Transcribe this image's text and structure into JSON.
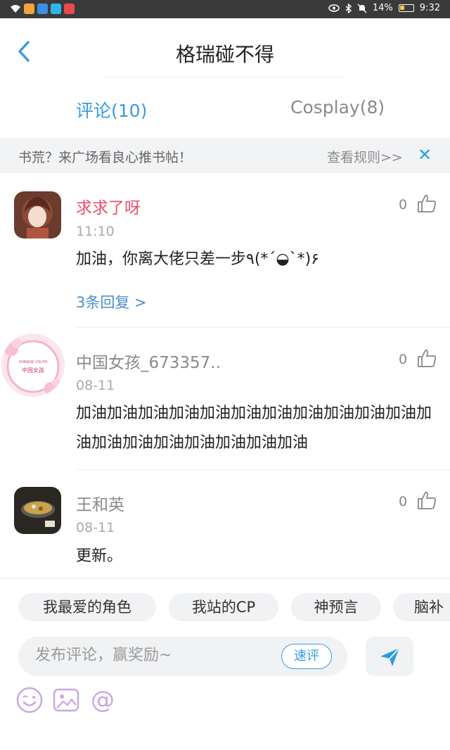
{
  "status_bar": {
    "battery": "14%",
    "time": "9:32",
    "app_icon_colors": [
      "#f2a33a",
      "#3a8ee6",
      "#2fb6f0",
      "#e94b4b"
    ]
  },
  "header": {
    "title": "格瑞碰不得",
    "back_icon": "chevron-left-icon"
  },
  "tabs": [
    {
      "label": "评论(10)",
      "active": true
    },
    {
      "label": "Cosplay(8)",
      "active": false
    }
  ],
  "notice": {
    "text": "书荒？来广场看良心推书帖！",
    "rule_link": "查看规则>>",
    "close_icon": "close-icon"
  },
  "comments": [
    {
      "name": "求求了呀",
      "time": "11:10",
      "text": "加油，你离大佬只差一步٩(*´◒`*)۶",
      "replies": "3条回复 >",
      "likes": "0"
    },
    {
      "name": "中国女孩_673357..",
      "time": "08-11",
      "text": "加油加油加油加油加油加油加油加油加油加油加油加油加油加油加油加油加油加油加油",
      "likes": "0",
      "avatar_text": {
        "top": "CHINESE YOUTH",
        "middle": "中国女孩"
      }
    },
    {
      "name": "王和英",
      "time": "08-11",
      "text": "更新。",
      "likes": "0"
    }
  ],
  "bottom": {
    "chips": [
      "我最爱的角色",
      "我站的CP",
      "神预言",
      "脑补"
    ],
    "input_placeholder": "发布评论，赢奖励~",
    "quick_comment": "速评",
    "send_icon": "send-icon",
    "tool_icons": [
      "emoji-icon",
      "image-icon",
      "mention-icon"
    ]
  },
  "colors": {
    "accent": "#3a9be0",
    "hot_name": "#e9506a",
    "reply_link": "#4d8fce",
    "close": "#2d9be6"
  }
}
